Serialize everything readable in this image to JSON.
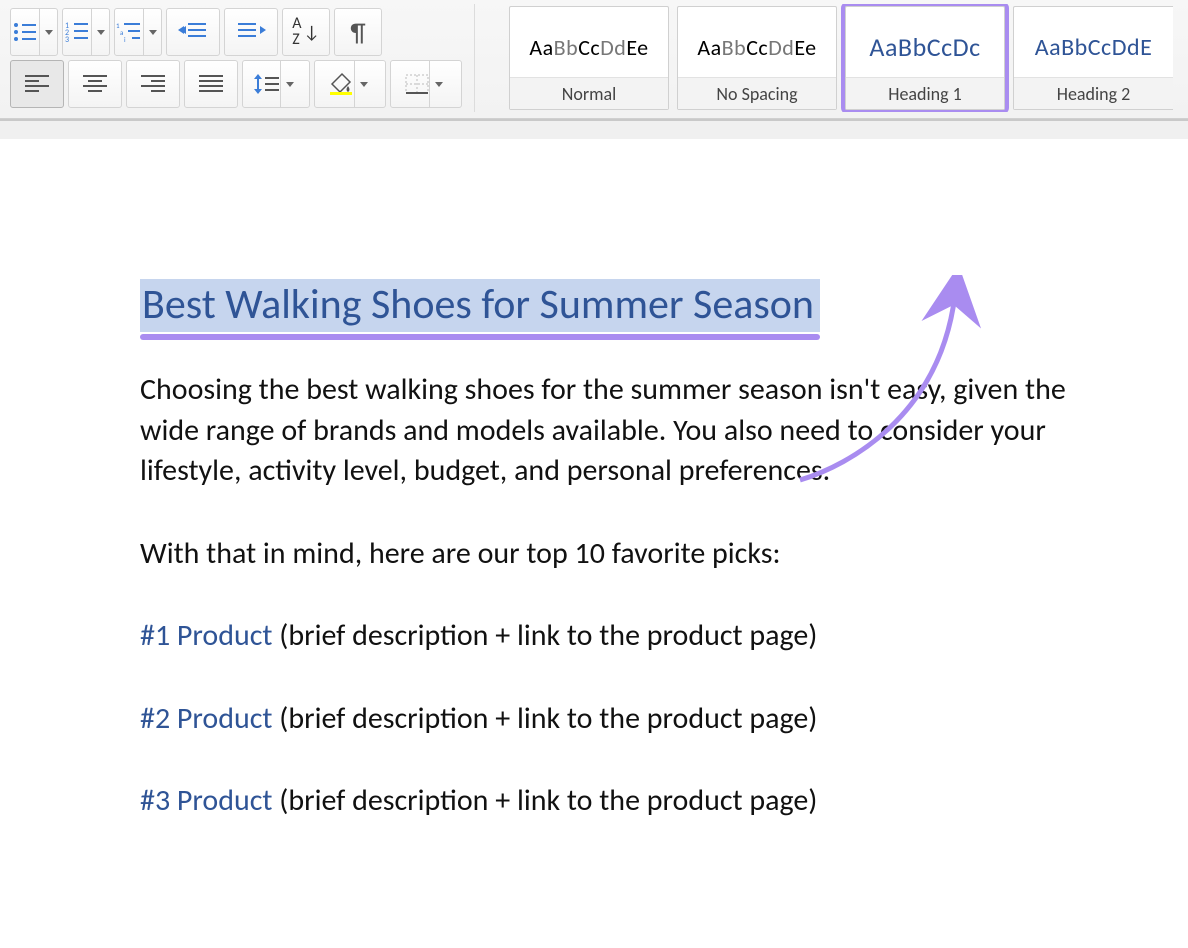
{
  "styles": {
    "preview_mixed": "AaBbCcDdEe",
    "preview_short": "AaBbCcDc",
    "preview_long_cut": "AaBbCcDdE",
    "normal": "Normal",
    "no_spacing": "No Spacing",
    "heading1": "Heading 1",
    "heading2": "Heading 2"
  },
  "doc": {
    "heading": "Best Walking Shoes for Summer Season",
    "para1": "Choosing the best walking shoes for the summer season isn't easy, given the wide range of brands and models available. You also need to consider your lifestyle, activity level, budget, and personal preferences.",
    "para2": "With that in mind, here are our top 10 favorite picks:",
    "products": [
      {
        "name": "#1 Product",
        "desc": " (brief description + link to the product page)"
      },
      {
        "name": "#2 Product",
        "desc": " (brief description + link to the product page)"
      },
      {
        "name": "#3 Product",
        "desc": " (brief description + link to the product page)"
      }
    ]
  }
}
